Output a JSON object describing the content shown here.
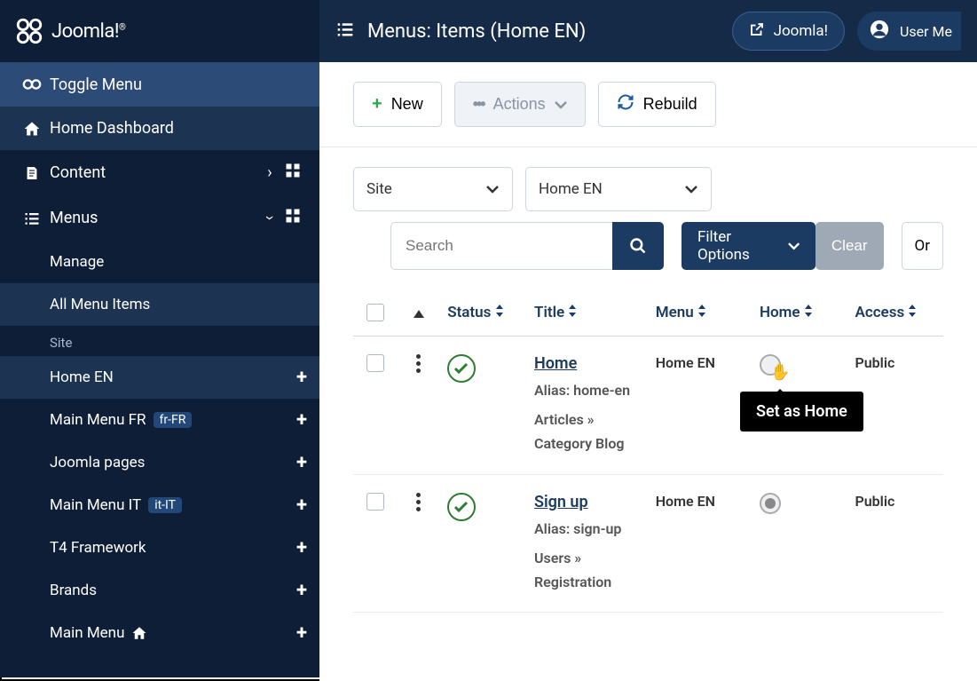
{
  "logo": "Joomla!",
  "sidebar": {
    "toggle": "Toggle Menu",
    "dashboard": "Home Dashboard",
    "content": "Content",
    "menus": "Menus",
    "manage": "Manage",
    "all_items": "All Menu Items",
    "site_label": "Site",
    "home_en": "Home EN",
    "main_fr": "Main Menu FR",
    "main_fr_badge": "fr-FR",
    "joomla_pages": "Joomla pages",
    "main_it": "Main Menu IT",
    "main_it_badge": "it-IT",
    "t4": "T4 Framework",
    "brands": "Brands",
    "main_menu": "Main Menu"
  },
  "header": {
    "title": "Menus: Items (Home EN)",
    "joomla_btn": "Joomla!",
    "user_btn": "User Me"
  },
  "toolbar": {
    "new": "New",
    "actions": "Actions",
    "rebuild": "Rebuild"
  },
  "filters": {
    "site": "Site",
    "menu_select": "Home EN",
    "search_placeholder": "Search",
    "filter_options": "Filter Options",
    "clear": "Clear",
    "ordering": "Or"
  },
  "columns": {
    "status": "Status",
    "title": "Title",
    "menu": "Menu",
    "home": "Home",
    "access": "Access"
  },
  "rows": [
    {
      "title": "Home",
      "alias": "Alias: home-en",
      "crumb": "Articles » Category Blog",
      "menu": "Home EN",
      "access": "Public"
    },
    {
      "title": "Sign up",
      "alias": "Alias: sign-up",
      "crumb": "Users » Registration",
      "menu": "Home EN",
      "access": "Public"
    }
  ],
  "tooltip": "Set as Home"
}
